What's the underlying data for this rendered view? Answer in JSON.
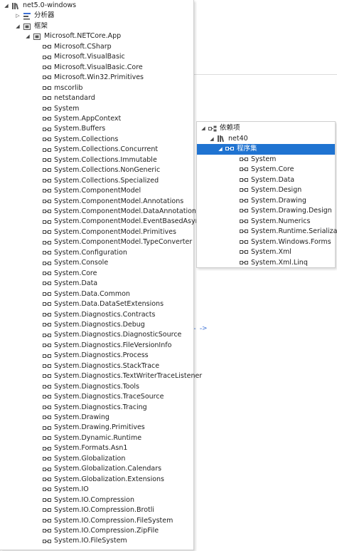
{
  "left_tree": {
    "root": "net5.0-windows",
    "analyzers": "分析器",
    "frameworks": "框架",
    "framework_app": "Microsoft.NETCore.App",
    "refs": [
      "Microsoft.CSharp",
      "Microsoft.VisualBasic",
      "Microsoft.VisualBasic.Core",
      "Microsoft.Win32.Primitives",
      "mscorlib",
      "netstandard",
      "System",
      "System.AppContext",
      "System.Buffers",
      "System.Collections",
      "System.Collections.Concurrent",
      "System.Collections.Immutable",
      "System.Collections.NonGeneric",
      "System.Collections.Specialized",
      "System.ComponentModel",
      "System.ComponentModel.Annotations",
      "System.ComponentModel.DataAnnotations",
      "System.ComponentModel.EventBasedAsync",
      "System.ComponentModel.Primitives",
      "System.ComponentModel.TypeConverter",
      "System.Configuration",
      "System.Console",
      "System.Core",
      "System.Data",
      "System.Data.Common",
      "System.Data.DataSetExtensions",
      "System.Diagnostics.Contracts",
      "System.Diagnostics.Debug",
      "System.Diagnostics.DiagnosticSource",
      "System.Diagnostics.FileVersionInfo",
      "System.Diagnostics.Process",
      "System.Diagnostics.StackTrace",
      "System.Diagnostics.TextWriterTraceListener",
      "System.Diagnostics.Tools",
      "System.Diagnostics.TraceSource",
      "System.Diagnostics.Tracing",
      "System.Drawing",
      "System.Drawing.Primitives",
      "System.Dynamic.Runtime",
      "System.Formats.Asn1",
      "System.Globalization",
      "System.Globalization.Calendars",
      "System.Globalization.Extensions",
      "System.IO",
      "System.IO.Compression",
      "System.IO.Compression.Brotli",
      "System.IO.Compression.FileSystem",
      "System.IO.Compression.ZipFile",
      "System.IO.FileSystem"
    ]
  },
  "right_tree": {
    "dependencies": "依赖项",
    "target": "net40",
    "assemblies": "程序集",
    "refs": [
      "System",
      "System.Core",
      "System.Data",
      "System.Design",
      "System.Drawing",
      "System.Drawing.Design",
      "System.Numerics",
      "System.Runtime.Serialization",
      "System.Windows.Forms",
      "System.Xml",
      "System.Xml.Linq"
    ]
  },
  "colors": {
    "selection": "#1f73d1",
    "link_dash": "#3b6fd4"
  },
  "icons": {
    "expanded": "expanded-arrow-icon",
    "collapsed": "collapsed-arrow-icon",
    "library": "library-icon",
    "analyzer": "analyzer-icon",
    "framework": "framework-icon",
    "reference": "reference-icon",
    "dependencies": "dependencies-icon"
  }
}
